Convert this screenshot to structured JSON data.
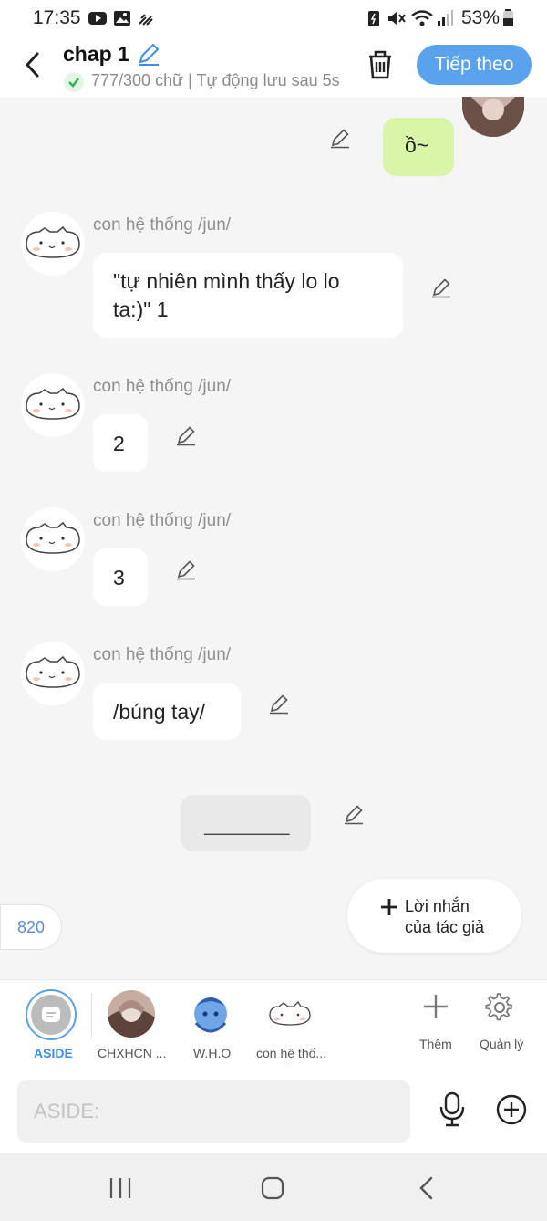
{
  "status_bar": {
    "time": "17:35",
    "battery": "53%"
  },
  "header": {
    "title": "chap 1",
    "subtitle": "777/300 chữ | Tự động lưu sau 5s",
    "next_label": "Tiếp theo"
  },
  "messages": [
    {
      "type": "outgoing",
      "text": "ồ~"
    },
    {
      "sender": "con hệ thống /jun/",
      "text_line1": "\"tự nhiên mình thấy lo lo",
      "text_line2": "ta:)\" 1"
    },
    {
      "sender": "con hệ thống /jun/",
      "text": "2"
    },
    {
      "sender": "con hệ thống /jun/",
      "text": "3"
    },
    {
      "sender": "con hệ thống /jun/",
      "text": "/búng tay/"
    },
    {
      "type": "aside",
      "text": "________"
    }
  ],
  "count_badge": "820",
  "author_note": {
    "line1": "Lời nhắn",
    "line2": "của tác giả"
  },
  "characters": [
    {
      "label": "ASIDE"
    },
    {
      "label": "CHXHCN ..."
    },
    {
      "label": "W.H.O"
    },
    {
      "label": "con hệ thố..."
    }
  ],
  "char_actions": {
    "add_label": "Thêm",
    "manage_label": "Quản lý"
  },
  "composer": {
    "placeholder": "ASIDE:"
  },
  "colors": {
    "accent": "#5aa2ec",
    "outgoing_bubble": "#d9f5a8",
    "aside_blue": "#3c8ee6"
  }
}
